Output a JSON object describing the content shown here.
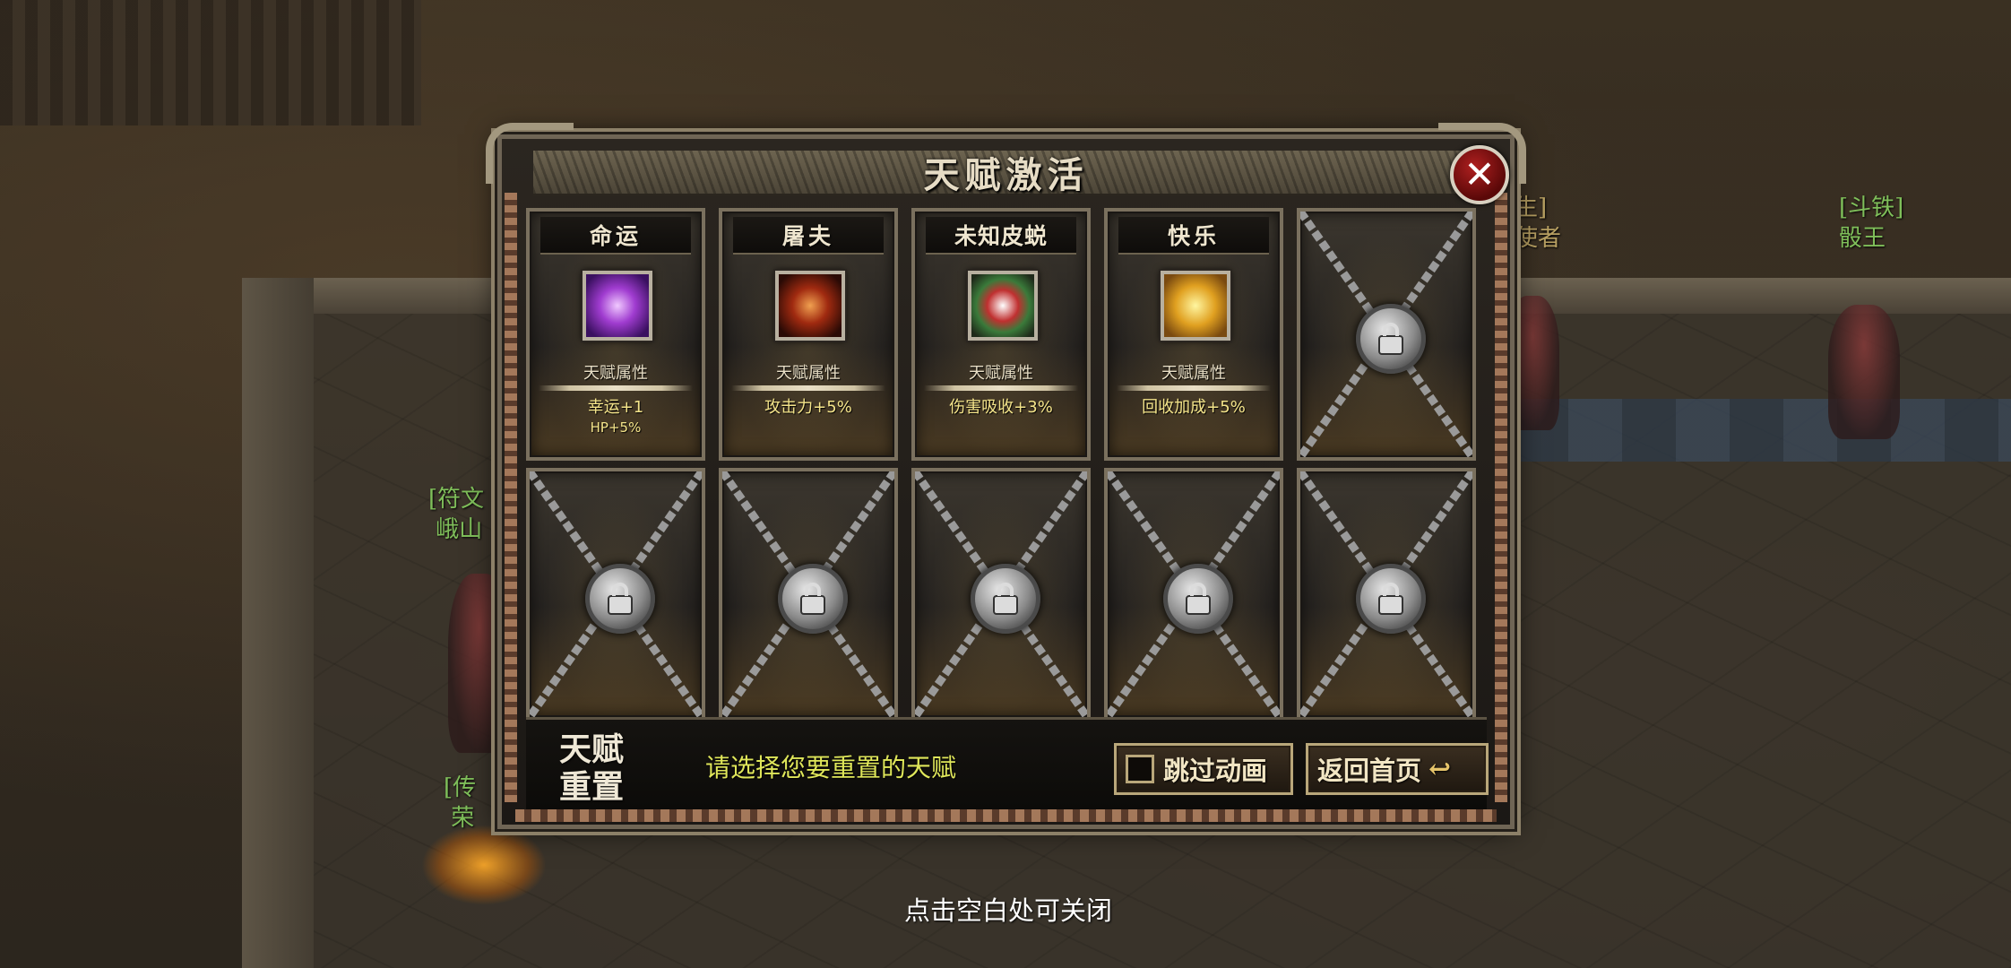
{
  "background": {
    "npc_names": [
      {
        "text": "生]\n使者",
        "color": "#b8a062"
      },
      {
        "text": "[斗铁]\n骰王",
        "color": "#7fbf5a"
      },
      {
        "text": "[符文\n 峨山",
        "color": "#7fbf5a"
      },
      {
        "text": "[传\n 荣",
        "color": "#7fbf5a"
      }
    ]
  },
  "dialog": {
    "title": "天赋激活",
    "close_icon": "close-icon",
    "cards": [
      {
        "name": "命运",
        "icon": "fate-talent-icon",
        "attr_label": "天赋属性",
        "value_line1": "幸运+1",
        "value_line2": "HP+5%",
        "locked": false
      },
      {
        "name": "屠夫",
        "icon": "butcher-talent-icon",
        "attr_label": "天赋属性",
        "value_line1": "攻击力+5%",
        "value_line2": "",
        "locked": false
      },
      {
        "name": "未知皮蜕",
        "icon": "unknown-skin-talent-icon",
        "attr_label": "天赋属性",
        "value_line1": "伤害吸收+3%",
        "value_line2": "",
        "locked": false
      },
      {
        "name": "快乐",
        "icon": "joy-talent-icon",
        "attr_label": "天赋属性",
        "value_line1": "回收加成+5%",
        "value_line2": "",
        "locked": false
      },
      {
        "locked": true
      },
      {
        "locked": true
      },
      {
        "locked": true
      },
      {
        "locked": true
      },
      {
        "locked": true
      },
      {
        "locked": true
      }
    ],
    "bottom": {
      "reset_title": "天赋重置",
      "prompt": "请选择您要重置的天赋",
      "skip_label": "跳过动画",
      "home_label": "返回首页"
    }
  },
  "close_hint": "点击空白处可关闭",
  "colors": {
    "prompt": "#dfe65a",
    "attr_value": "#f4e48a",
    "close_button": "#b02020"
  }
}
